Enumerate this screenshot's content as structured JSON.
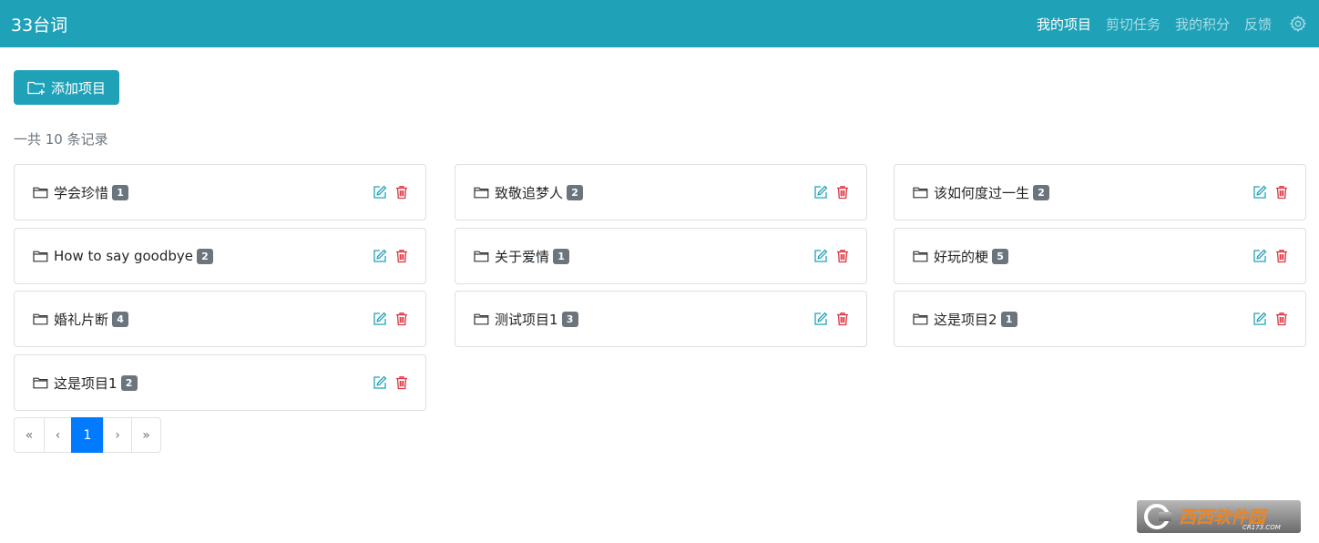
{
  "navbar": {
    "brand": "33台词",
    "links": [
      {
        "label": "我的项目",
        "active": true
      },
      {
        "label": "剪切任务",
        "active": false
      },
      {
        "label": "我的积分",
        "active": false
      },
      {
        "label": "反馈",
        "active": false
      }
    ],
    "settings_icon": "gear-icon",
    "bg_color": "#1fa2b8"
  },
  "toolbar": {
    "add_label": "添加项目",
    "add_icon": "folder-plus-icon"
  },
  "records": {
    "summary": "一共 10 条记录"
  },
  "projects": [
    {
      "name": "学会珍惜",
      "count": "1"
    },
    {
      "name": "致敬追梦人",
      "count": "2"
    },
    {
      "name": "该如何度过一生",
      "count": "2"
    },
    {
      "name": "How to say goodbye",
      "count": "2"
    },
    {
      "name": "关于爱情",
      "count": "1"
    },
    {
      "name": "好玩的梗",
      "count": "5"
    },
    {
      "name": "婚礼片断",
      "count": "4"
    },
    {
      "name": "测试项目1",
      "count": "3"
    },
    {
      "name": "这是项目2",
      "count": "1"
    },
    {
      "name": "这是项目1",
      "count": "2"
    }
  ],
  "card_icons": {
    "folder": "folder-icon",
    "edit": "edit-icon",
    "delete": "trash-icon"
  },
  "pagination": {
    "first": "«",
    "prev": "‹",
    "current": "1",
    "next": "›",
    "last": "»"
  },
  "colors": {
    "accent": "#1fa2b8",
    "delete": "#dc3545",
    "badge": "#6c757d",
    "page_active": "#007bff"
  },
  "watermark": {
    "text": "西西软件园",
    "sub": "CR173.COM"
  }
}
